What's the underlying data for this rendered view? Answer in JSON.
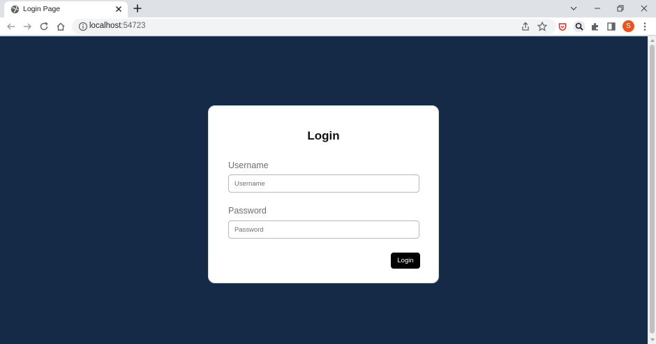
{
  "browser": {
    "tab": {
      "title": "Login Page",
      "favicon": "globe-icon"
    },
    "address": {
      "host": "localhost",
      "port": ":54723"
    },
    "profile_initial": "S"
  },
  "login": {
    "title": "Login",
    "username": {
      "label": "Username",
      "placeholder": "Username",
      "value": ""
    },
    "password": {
      "label": "Password",
      "placeholder": "Password",
      "value": ""
    },
    "submit_label": "Login"
  },
  "colors": {
    "page_background": "#142a46",
    "card_background": "#ffffff",
    "button_background": "#000000",
    "avatar": "#e8541e"
  }
}
